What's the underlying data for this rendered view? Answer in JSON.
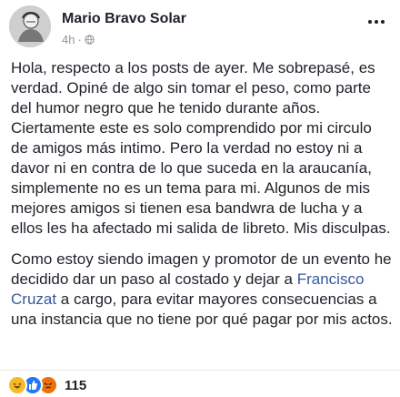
{
  "post": {
    "author": "Mario Bravo Solar",
    "time": "4h",
    "separator": "·",
    "privacy_icon": "globe-icon",
    "more_icon": "more-options-icon",
    "paragraphs": {
      "p1": "Hola, respecto a los posts de ayer. Me sobrepasé, es verdad. Opiné de algo sin tomar el peso, como parte del humor negro que he tenido durante años. Ciertamente este es solo comprendido por mi circulo de amigos más intimo. Pero la verdad no estoy ni a davor ni en contra de lo que suceda en la araucanía, simplemente no es un tema para mi. Algunos de mis mejores amigos si tienen esa bandwra de lucha y a ellos les ha afectado mi salida de libreto. Mis disculpas.",
      "p2_before": "Como estoy siendo imagen y promotor de un evento he decidido dar un paso al costado y dejar a ",
      "p2_mention": "Francisco Cruzat",
      "p2_after": " a cargo, para evitar mayores consecuencias a una instancia que no tiene por qué pagar por mis actos."
    },
    "reactions": {
      "icons": [
        "haha-reaction-icon",
        "like-reaction-icon",
        "angry-reaction-icon"
      ],
      "count": "115"
    }
  }
}
